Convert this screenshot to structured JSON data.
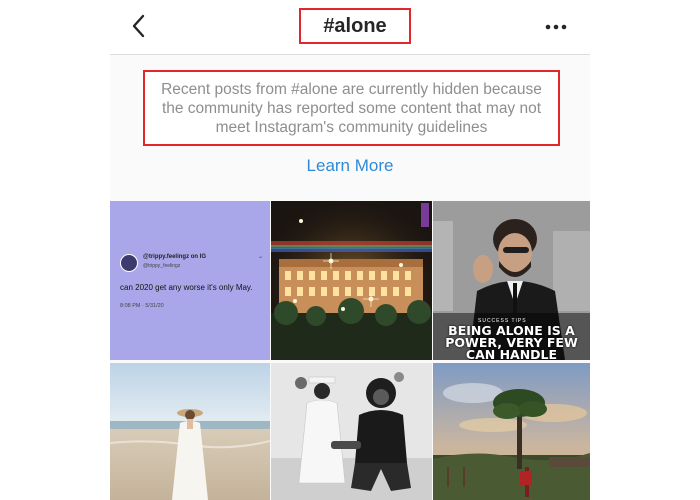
{
  "header": {
    "title": "#alone",
    "back_icon": "chevron-left-icon",
    "more_icon": "more-horizontal-icon"
  },
  "notice": {
    "text": "Recent posts from #alone are currently hidden because the community has reported some content that may not meet Instagram's community guidelines",
    "link_label": "Learn More",
    "highlight_color": "#e3262b",
    "link_color": "#2f8ad8"
  },
  "posts": [
    {
      "kind": "tweet",
      "handle": "@trippy.feelingz on IG",
      "subhandle": "@trippy_feelingz",
      "text": "can 2020 get any worse it's only May.",
      "time": "8:08 PM · 5/31/20"
    },
    {
      "kind": "photo",
      "subject": "night-building"
    },
    {
      "kind": "quote",
      "label": "SUCCESS TIPS",
      "text": "BEING ALONE IS A POWER, VERY FEW CAN HANDLE"
    },
    {
      "kind": "photo",
      "subject": "beach"
    },
    {
      "kind": "photo",
      "subject": "graduation"
    },
    {
      "kind": "photo",
      "subject": "tree-sunset"
    }
  ]
}
